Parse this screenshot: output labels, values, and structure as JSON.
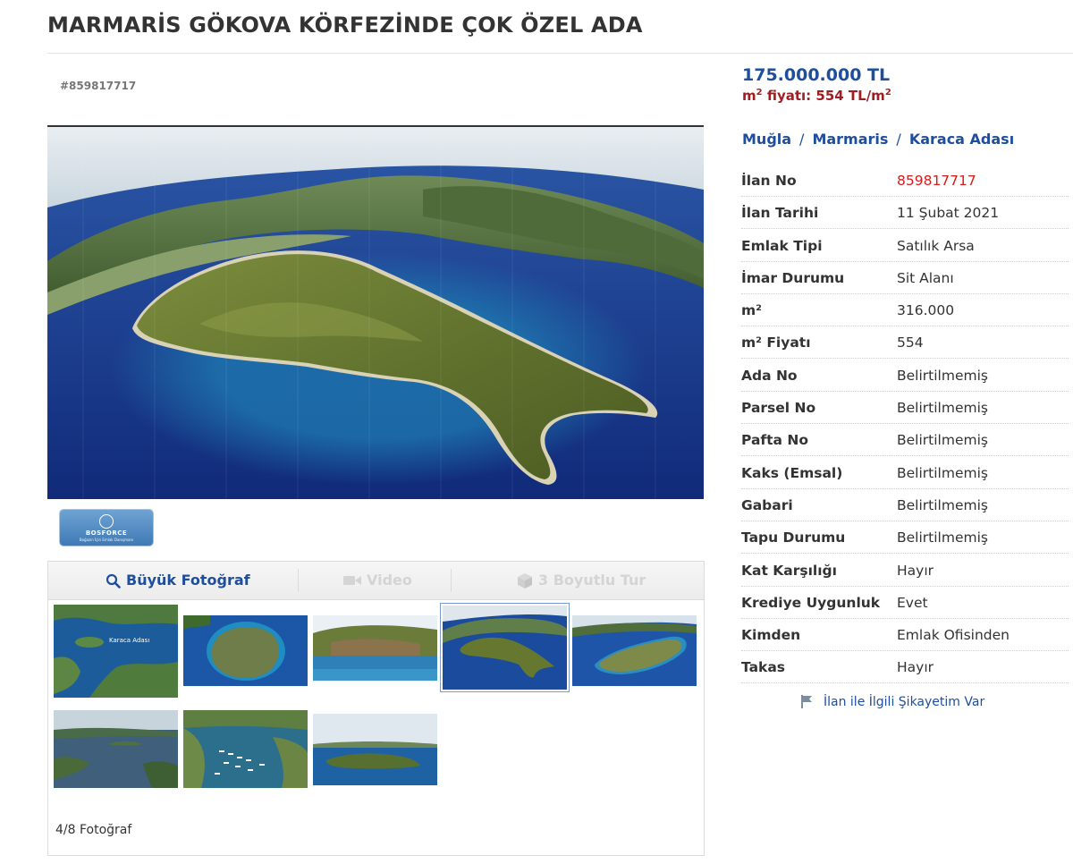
{
  "title": "MARMARİS GÖKOVA KÖRFEZİNDE ÇOK ÖZEL ADA",
  "listing_id_label": "#859817717",
  "price": "175.000.000 TL",
  "unit_price": {
    "prefix": "m",
    "sup": "2",
    "middle": " fiyatı: 554 TL/m",
    "sup2": "2"
  },
  "breadcrumb": [
    "Muğla",
    "Marmaris",
    "Karaca Adası"
  ],
  "breadcrumb_separator": "/",
  "details": [
    {
      "label": "İlan No",
      "value": "859817717",
      "highlight": true
    },
    {
      "label": "İlan Tarihi",
      "value": "11 Şubat 2021"
    },
    {
      "label": "Emlak Tipi",
      "value": "Satılık Arsa"
    },
    {
      "label": "İmar Durumu",
      "value": "Sit Alanı"
    },
    {
      "label": "m²",
      "value": "316.000"
    },
    {
      "label": "m² Fiyatı",
      "value": "554"
    },
    {
      "label": "Ada No",
      "value": "Belirtilmemiş"
    },
    {
      "label": "Parsel No",
      "value": "Belirtilmemiş"
    },
    {
      "label": "Pafta No",
      "value": "Belirtilmemiş"
    },
    {
      "label": "Kaks (Emsal)",
      "value": "Belirtilmemiş"
    },
    {
      "label": "Gabari",
      "value": "Belirtilmemiş"
    },
    {
      "label": "Tapu Durumu",
      "value": "Belirtilmemiş"
    },
    {
      "label": "Kat Karşılığı",
      "value": "Hayır"
    },
    {
      "label": "Krediye Uygunluk",
      "value": "Evet"
    },
    {
      "label": "Kimden",
      "value": "Emlak Ofisinden"
    },
    {
      "label": "Takas",
      "value": "Hayır"
    }
  ],
  "gallery": {
    "tabs": {
      "large_photo": "Büyük Fotoğraf",
      "video": "Video",
      "tour": "3 Boyutlu Tur"
    },
    "counter": "4/8 Fotoğraf",
    "selected_index": 3,
    "thumbnail_count": 8
  },
  "agency_logo": {
    "name": "BOSFORCE",
    "slogan": "Boğazın İçin Emlak Danışmanı"
  },
  "thumbnail_label": "Karaca Adası",
  "complaint_link": "İlan ile İlgili Şikayetim Var",
  "icons": {
    "search": "magnifier-icon",
    "video": "video-camera-icon",
    "tour": "cube-3d-icon",
    "flag": "flag-icon"
  },
  "colors": {
    "link_blue": "#1f4e9c",
    "price_red": "#a11d21",
    "id_red": "#d81b1b"
  }
}
